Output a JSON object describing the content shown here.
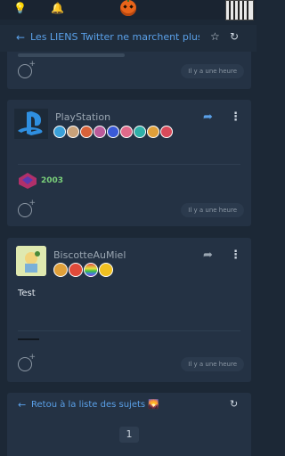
{
  "topbar": {
    "icons": [
      "lightbulb-icon",
      "bell-icon",
      "pumpkin-logo",
      "user-avatar"
    ]
  },
  "title": {
    "back_icon": "←",
    "text": "Les LIENS Twitter ne marchent plus❗",
    "star_icon": "☆",
    "refresh_icon": "↻"
  },
  "posts": [
    {
      "time": "Il y a une heure"
    },
    {
      "username": "PlayStation",
      "badge_count": 9,
      "signature_text": "2003",
      "time": "Il y a une heure"
    },
    {
      "username": "BiscotteAuMiel",
      "badge_count": 4,
      "body": "Test",
      "time": "Il y a une heure"
    }
  ],
  "footer": {
    "back_link": "Retou à la liste des sujets 🌄",
    "refresh_icon": "↻",
    "page": "1"
  },
  "colors": {
    "accent": "#5aa0e8",
    "background": "#1c2836",
    "card": "#243244"
  }
}
